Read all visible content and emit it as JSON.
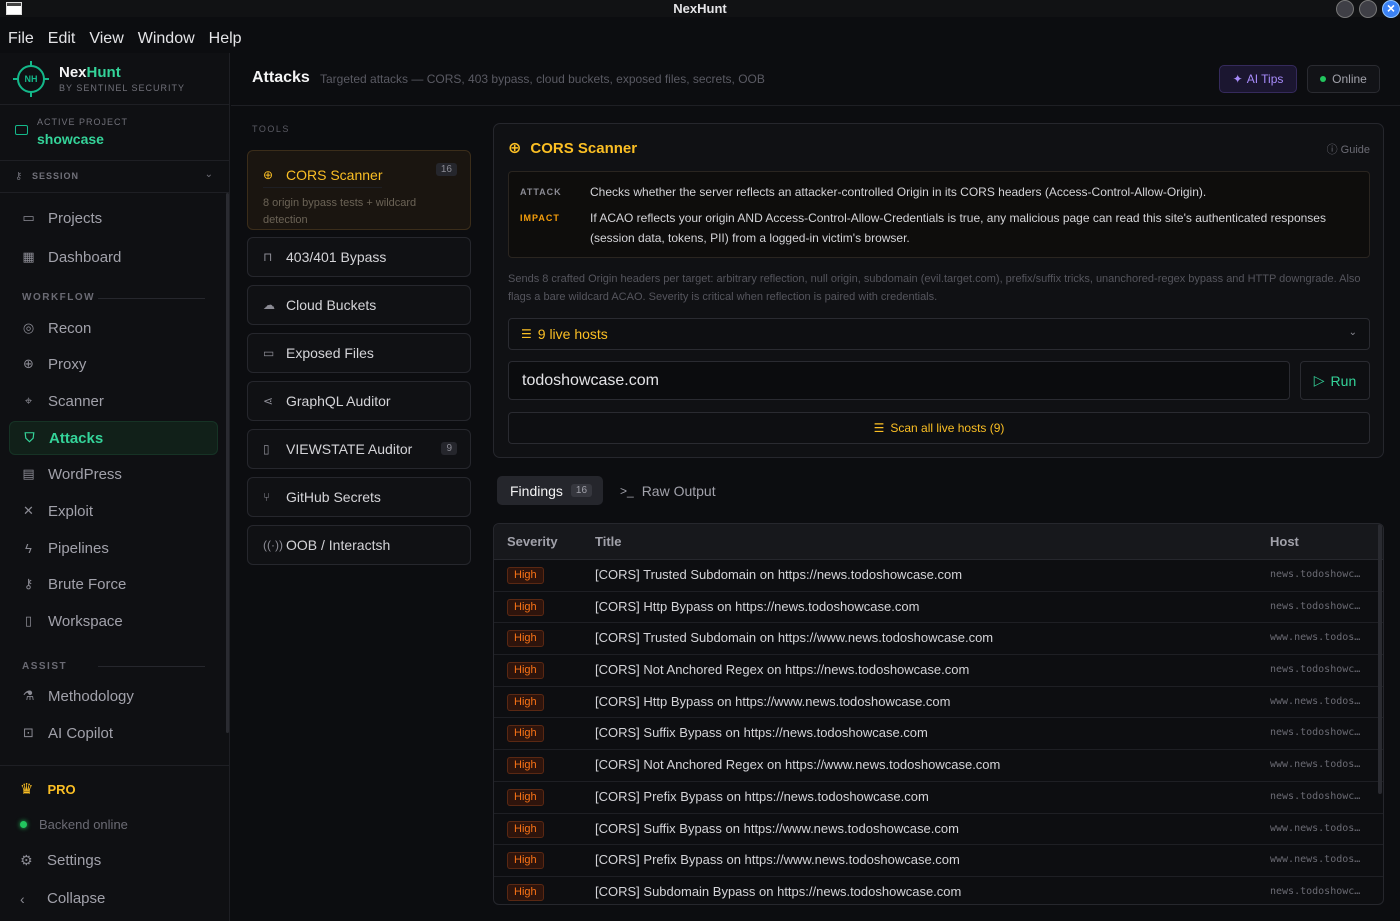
{
  "window": {
    "title": "NexHunt"
  },
  "menu": [
    "File",
    "Edit",
    "Window",
    "Help"
  ],
  "menu_view": "View",
  "brand": {
    "logo": "NH",
    "name_a": "Nex",
    "name_b": "Hunt",
    "sub": "BY SENTINEL SECURITY"
  },
  "project": {
    "label": "ACTIVE PROJECT",
    "value": "showcase"
  },
  "session": {
    "label": "SESSION"
  },
  "nav": {
    "projects": "Projects",
    "dashboard": "Dashboard",
    "workflow_label": "WORKFLOW",
    "recon": "Recon",
    "proxy": "Proxy",
    "scanner": "Scanner",
    "attacks": "Attacks",
    "wordpress": "WordPress",
    "exploit": "Exploit",
    "pipelines": "Pipelines",
    "brute": "Brute Force",
    "workspace": "Workspace",
    "assist_label": "ASSIST",
    "methodology": "Methodology",
    "copilot": "AI Copilot"
  },
  "footer": {
    "pro": "PRO",
    "backend": "Backend online",
    "settings": "Settings",
    "collapse": "Collapse"
  },
  "header": {
    "title": "Attacks",
    "subtitle": "Targeted attacks — CORS, 403 bypass, cloud buckets, exposed files, secrets, OOB",
    "tips": "AI Tips",
    "online": "Online"
  },
  "tools": {
    "label": "TOOLS",
    "cors": {
      "name": "CORS Scanner",
      "count": "16",
      "desc": "8 origin bypass tests + wildcard detection"
    },
    "bypass": "403/401 Bypass",
    "buckets": "Cloud Buckets",
    "exposed": "Exposed Files",
    "graphql": "GraphQL Auditor",
    "viewstate": {
      "name": "VIEWSTATE Auditor",
      "count": "9"
    },
    "github": "GitHub Secrets",
    "oob": "OOB / Interactsh"
  },
  "scanner": {
    "title": "CORS Scanner",
    "guide": "Guide",
    "attack_tag": "ATTACK",
    "attack_text": "Checks whether the server reflects an attacker-controlled Origin in its CORS headers (Access-Control-Allow-Origin).",
    "impact_tag": "IMPACT",
    "impact_text": "If ACAO reflects your origin AND Access-Control-Allow-Credentials is true, any malicious page can read this site's authenticated responses (session data, tokens, PII) from a logged-in victim's browser.",
    "note": "Sends 8 crafted Origin headers per target: arbitrary reflection, null origin, subdomain (evil.target.com), prefix/suffix tricks, unanchored-regex bypass and HTTP downgrade. Also flags a bare wildcard ACAO. Severity is critical when reflection is paired with credentials.",
    "hosts": "9 live hosts",
    "target": "todoshowcase.com",
    "run": "Run",
    "scan_all": "Scan all live hosts (9)"
  },
  "tabs": {
    "findings": "Findings",
    "findings_count": "16",
    "raw": "Raw Output"
  },
  "table": {
    "headers": {
      "severity": "Severity",
      "title": "Title",
      "host": "Host"
    },
    "rows": [
      {
        "sev": "High",
        "title": "[CORS] Trusted Subdomain on https://news.todoshowcase.com",
        "host": "news.todoshowcase.com"
      },
      {
        "sev": "High",
        "title": "[CORS] Http Bypass on https://news.todoshowcase.com",
        "host": "news.todoshowcase.com"
      },
      {
        "sev": "High",
        "title": "[CORS] Trusted Subdomain on https://www.news.todoshowcase.com",
        "host": "www.news.todoshowcase.com"
      },
      {
        "sev": "High",
        "title": "[CORS] Not Anchored Regex on https://news.todoshowcase.com",
        "host": "news.todoshowcase.com"
      },
      {
        "sev": "High",
        "title": "[CORS] Http Bypass on https://www.news.todoshowcase.com",
        "host": "www.news.todoshowcase.com"
      },
      {
        "sev": "High",
        "title": "[CORS] Suffix Bypass on https://news.todoshowcase.com",
        "host": "news.todoshowcase.com"
      },
      {
        "sev": "High",
        "title": "[CORS] Not Anchored Regex on https://www.news.todoshowcase.com",
        "host": "www.news.todoshowcase.com"
      },
      {
        "sev": "High",
        "title": "[CORS] Prefix Bypass on https://news.todoshowcase.com",
        "host": "news.todoshowcase.com"
      },
      {
        "sev": "High",
        "title": "[CORS] Suffix Bypass on https://www.news.todoshowcase.com",
        "host": "www.news.todoshowcase.com"
      },
      {
        "sev": "High",
        "title": "[CORS] Prefix Bypass on https://www.news.todoshowcase.com",
        "host": "www.news.todoshowcase.com"
      },
      {
        "sev": "High",
        "title": "[CORS] Subdomain Bypass on https://news.todoshowcase.com",
        "host": "news.todoshowcase.com"
      }
    ]
  },
  "colors": {
    "accent": "#34d399",
    "warn": "#fbbf24",
    "high": "#f97316",
    "ai": "#a78bfa"
  }
}
